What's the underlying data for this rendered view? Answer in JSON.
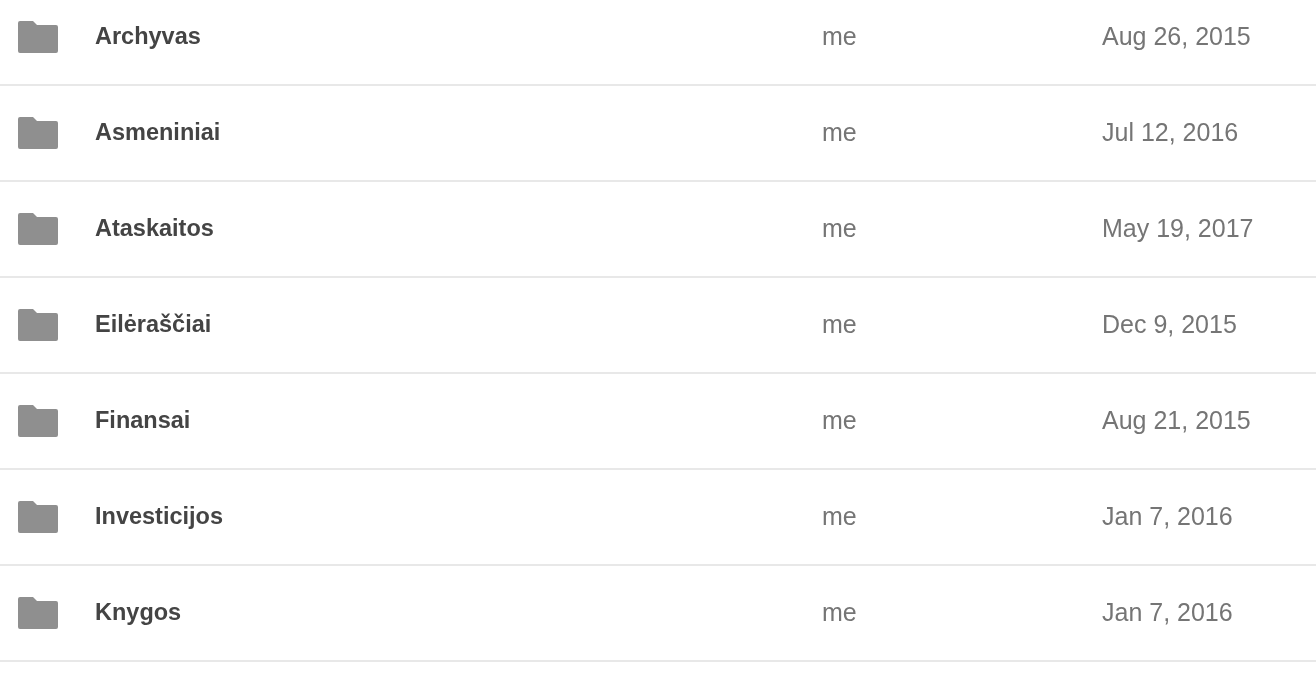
{
  "folders": [
    {
      "name": "Archyvas",
      "owner": "me",
      "modified": "Aug 26, 2015"
    },
    {
      "name": "Asmeniniai",
      "owner": "me",
      "modified": "Jul 12, 2016"
    },
    {
      "name": "Ataskaitos",
      "owner": "me",
      "modified": "May 19, 2017"
    },
    {
      "name": "Eilėraščiai",
      "owner": "me",
      "modified": "Dec 9, 2015"
    },
    {
      "name": "Finansai",
      "owner": "me",
      "modified": "Aug 21, 2015"
    },
    {
      "name": "Investicijos",
      "owner": "me",
      "modified": "Jan 7, 2016"
    },
    {
      "name": "Knygos",
      "owner": "me",
      "modified": "Jan 7, 2016"
    }
  ]
}
